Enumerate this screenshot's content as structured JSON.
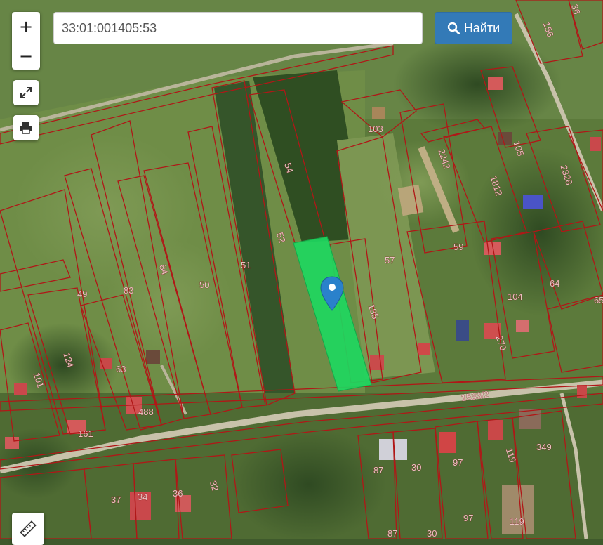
{
  "search": {
    "value": "33:01:001405:53",
    "button_label": "Найти",
    "button_icon": "search-icon"
  },
  "controls": {
    "zoom_in": "+",
    "zoom_out": "−",
    "icons": [
      "expand-icon",
      "print-icon",
      "ruler-icon"
    ]
  },
  "map": {
    "selected_parcel_color": "#1ed760",
    "boundary_color": "#b01717",
    "marker_color": "#2a81cb",
    "parcel_labels": [
      "36",
      "156",
      "103",
      "105",
      "2328",
      "54",
      "2242",
      "1812",
      "52",
      "57",
      "59",
      "51",
      "84",
      "50",
      "49",
      "83",
      "185",
      "64",
      "104",
      "65",
      "124",
      "63",
      "270",
      "101",
      "488",
      "161",
      "1533/2",
      "349",
      "87",
      "30",
      "97",
      "119",
      "37",
      "34",
      "36",
      "32",
      "97",
      "119",
      "87",
      "30"
    ]
  }
}
